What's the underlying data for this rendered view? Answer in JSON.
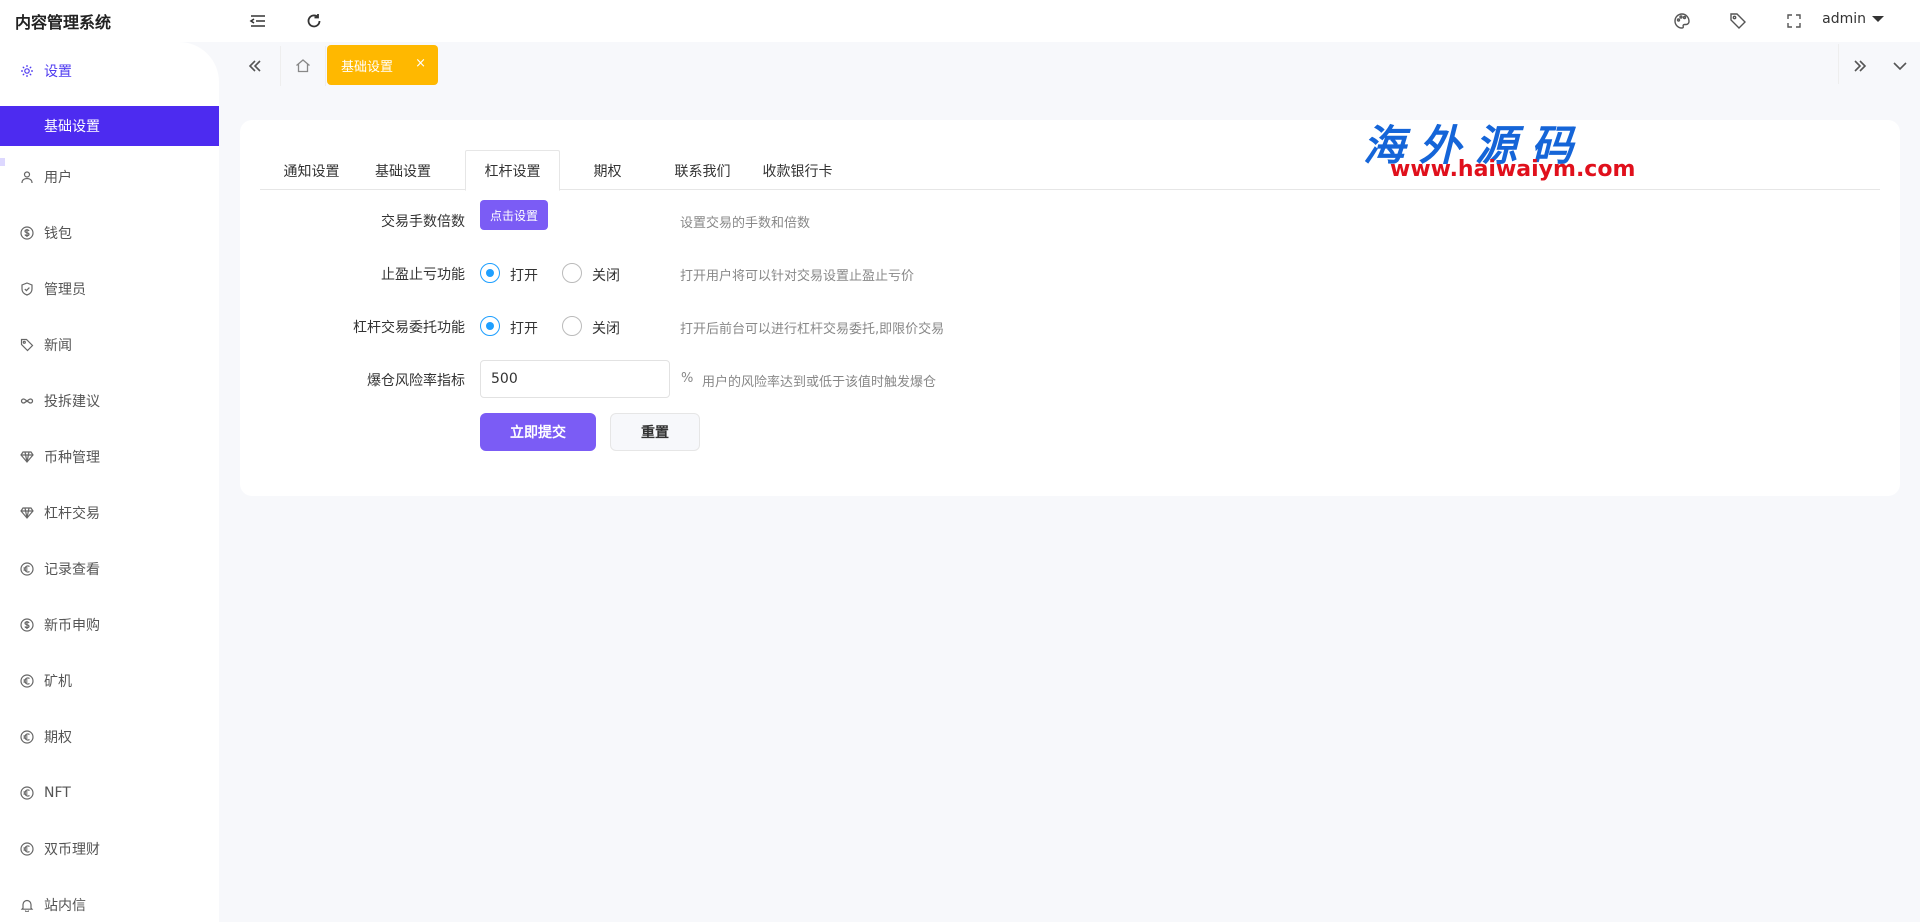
{
  "app": {
    "title": "内容管理系统"
  },
  "header": {
    "user": "admin"
  },
  "sidebar": {
    "items": [
      {
        "label": "设置",
        "icon": "gear-icon"
      },
      {
        "label": "用户",
        "icon": "user-icon"
      },
      {
        "label": "钱包",
        "icon": "dollar-icon"
      },
      {
        "label": "管理员",
        "icon": "shield-icon"
      },
      {
        "label": "新闻",
        "icon": "tag-icon"
      },
      {
        "label": "投拆建议",
        "icon": "infinity-icon"
      },
      {
        "label": "币种管理",
        "icon": "diamond-icon"
      },
      {
        "label": "杠杆交易",
        "icon": "diamond-icon"
      },
      {
        "label": "记录查看",
        "icon": "euro-icon"
      },
      {
        "label": "新币申购",
        "icon": "dollar-icon"
      },
      {
        "label": "矿机",
        "icon": "euro-icon"
      },
      {
        "label": "期权",
        "icon": "euro-icon"
      },
      {
        "label": "NFT",
        "icon": "euro-icon"
      },
      {
        "label": "双币理财",
        "icon": "euro-icon"
      },
      {
        "label": "站内信",
        "icon": "bell-icon"
      }
    ],
    "active_sub": "基础设置"
  },
  "page_tabs": {
    "current": "基础设置",
    "close": "×"
  },
  "settings_tabs": [
    "通知设置",
    "基础设置",
    "杠杆设置",
    "期权",
    "联系我们",
    "收款银行卡"
  ],
  "watermark": {
    "cn": "海外源码",
    "url": "www.haiwaiym.com"
  },
  "form": {
    "fee": {
      "label": "交易手数倍数",
      "button": "点击设置",
      "hint": "设置交易的手数和倍数"
    },
    "stop": {
      "label": "止盈止亏功能",
      "on": "打开",
      "off": "关闭",
      "hint": "打开用户将可以针对交易设置止盈止亏价"
    },
    "entrust": {
      "label": "杠杆交易委托功能",
      "on": "打开",
      "off": "关闭",
      "hint": "打开后前台可以进行杠杆交易委托,即限价交易"
    },
    "risk": {
      "label": "爆仓风险率指标",
      "value": "500",
      "unit": "%",
      "hint": "用户的风险率达到或低于该值时触发爆仓"
    },
    "submit": "立即提交",
    "reset": "重置"
  },
  "colors": {
    "primary": "#4d2bf0",
    "button": "#7b5cf5",
    "tab": "#ffb800",
    "radio": "#1e9fff"
  }
}
